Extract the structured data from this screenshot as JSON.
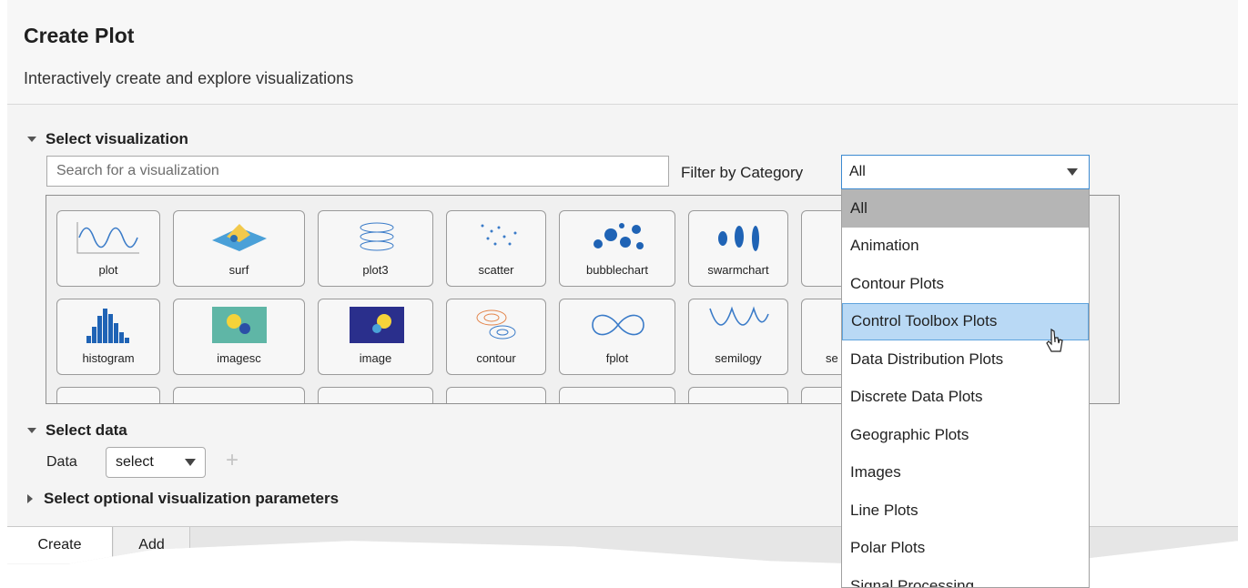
{
  "header": {
    "title": "Create Plot",
    "subtitle": "Interactively create and explore visualizations"
  },
  "select_visualization": {
    "heading": "Select visualization",
    "search_placeholder": "Search for a visualization",
    "filter_label": "Filter by Category",
    "filter_value": "All",
    "gallery": [
      {
        "label": "plot",
        "icon": "sine-wave-icon"
      },
      {
        "label": "surf",
        "icon": "surface-3d-icon"
      },
      {
        "label": "plot3",
        "icon": "helix-3d-icon"
      },
      {
        "label": "scatter",
        "icon": "scatter-points-icon"
      },
      {
        "label": "bubblechart",
        "icon": "bubble-chart-icon"
      },
      {
        "label": "swarmchart",
        "icon": "swarm-chart-icon"
      },
      {
        "label": "",
        "icon": "partial-plot-icon"
      },
      {
        "label": "histogram",
        "icon": "histogram-icon"
      },
      {
        "label": "imagesc",
        "icon": "imagesc-heatmap-icon"
      },
      {
        "label": "image",
        "icon": "image-heatmap-icon"
      },
      {
        "label": "contour",
        "icon": "contour-icon"
      },
      {
        "label": "fplot",
        "icon": "infinity-curve-icon"
      },
      {
        "label": "semilogy",
        "icon": "semilog-curve-icon"
      },
      {
        "label": "se",
        "icon": "partial-plot-icon"
      }
    ]
  },
  "select_data": {
    "heading": "Select data",
    "data_label": "Data",
    "data_select_value": "select",
    "add_symbol": "+"
  },
  "optional_params": {
    "heading": "Select optional visualization parameters"
  },
  "tabs": [
    {
      "label": "Create"
    },
    {
      "label": "Add"
    }
  ],
  "dropdown": {
    "options": [
      "All",
      "Animation",
      "Contour Plots",
      "Control Toolbox Plots",
      "Data Distribution Plots",
      "Discrete Data Plots",
      "Geographic Plots",
      "Images",
      "Line Plots",
      "Polar Plots",
      "Signal Processing"
    ],
    "selected": "All",
    "hovered": "Control Toolbox Plots"
  },
  "colors": {
    "focus_border": "#3c8ad1",
    "hover_bg": "#b9d9f5",
    "selected_bg": "#b5b5b5"
  }
}
